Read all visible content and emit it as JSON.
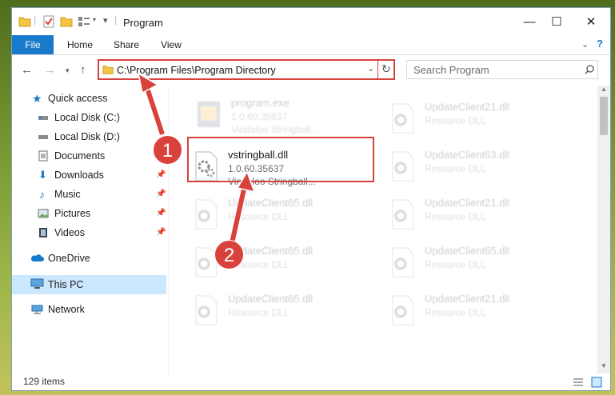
{
  "window": {
    "title": "Program"
  },
  "ribbon": {
    "tabs": [
      "File",
      "Home",
      "Share",
      "View"
    ]
  },
  "address": {
    "path": "C:\\Program Files\\Program Directory"
  },
  "search": {
    "placeholder": "Search Program"
  },
  "sidebar": {
    "items": [
      {
        "label": "Quick access",
        "icon": "star-icon"
      },
      {
        "label": "Local Disk (C:)",
        "icon": "drive-icon"
      },
      {
        "label": "Local Disk (D:)",
        "icon": "drive-icon"
      },
      {
        "label": "Documents",
        "icon": "documents-icon"
      },
      {
        "label": "Downloads",
        "icon": "download-icon",
        "pinned": true
      },
      {
        "label": "Music",
        "icon": "music-icon",
        "pinned": true
      },
      {
        "label": "Pictures",
        "icon": "pictures-icon",
        "pinned": true
      },
      {
        "label": "Videos",
        "icon": "videos-icon",
        "pinned": true
      },
      {
        "label": "OneDrive",
        "icon": "cloud-icon"
      },
      {
        "label": "This PC",
        "icon": "computer-icon",
        "selected": true
      },
      {
        "label": "Network",
        "icon": "network-icon"
      }
    ]
  },
  "files": {
    "left": [
      {
        "name": "program.exe",
        "line1": "1.0.60.35637",
        "line2": "Vindaloo Stringball...",
        "faded": true
      },
      {
        "name": "vstringball.dll",
        "line1": "1.0.60.35637",
        "line2": "Vindaloo Stringball...",
        "faded": false
      },
      {
        "name": "UpdateClient65.dll",
        "line1": "Resource DLL",
        "line2": "",
        "faded": true
      },
      {
        "name": "UpdateClient65.dll",
        "line1": "Resource DLL",
        "line2": "",
        "faded": true
      },
      {
        "name": "UpdateClient65.dll",
        "line1": "Resource DLL",
        "line2": "",
        "faded": true
      }
    ],
    "right": [
      {
        "name": "UpdateClient21.dll",
        "line1": "Resource DLL"
      },
      {
        "name": "UpdateClient63.dll",
        "line1": "Resource DLL"
      },
      {
        "name": "UpdateClient21.dll",
        "line1": "Resource DLL"
      },
      {
        "name": "UpdateClient65.dll",
        "line1": "Resource DLL"
      },
      {
        "name": "UpdateClient21.dll",
        "line1": "Resource DLL"
      }
    ]
  },
  "annotations": {
    "badge1": "1",
    "badge2": "2"
  },
  "status": {
    "item_count": "129 items"
  },
  "colors": {
    "accent": "#1979ca",
    "annotation": "#d9413c",
    "selection": "#cce8ff"
  }
}
